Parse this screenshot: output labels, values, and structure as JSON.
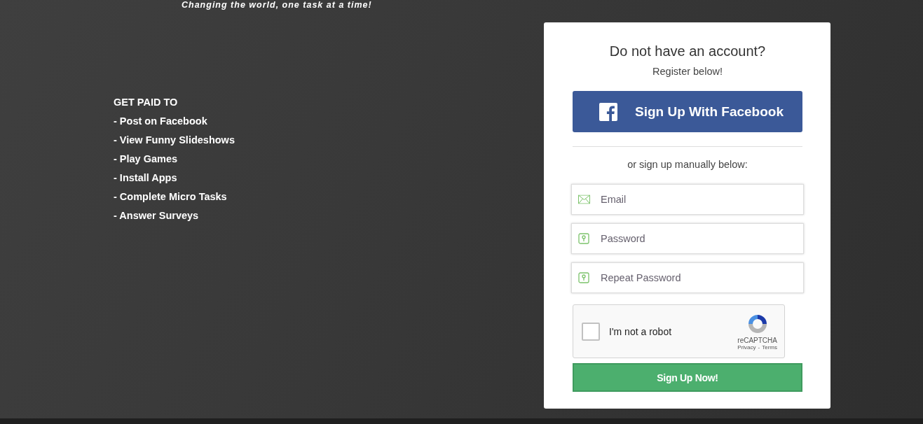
{
  "tagline": "Changing the world, one task at a time!",
  "promo": {
    "heading": "GET PAID TO",
    "items": [
      "- Post on Facebook",
      "- View Funny Slideshows",
      "- Play Games",
      "- Install Apps",
      "- Complete Micro Tasks",
      "- Answer Surveys"
    ]
  },
  "signup": {
    "title": "Do not have an account?",
    "subtitle": "Register below!",
    "facebook_button": "Sign Up With Facebook",
    "divider_text": "or sign up manually below:",
    "fields": [
      {
        "kind": "email",
        "placeholder": "Email"
      },
      {
        "kind": "password",
        "placeholder": "Password"
      },
      {
        "kind": "password",
        "placeholder": "Repeat Password"
      }
    ],
    "captcha": {
      "label": "I'm not a robot",
      "checked": false,
      "brand": "reCAPTCHA",
      "links": [
        "Privacy",
        "Terms"
      ],
      "separator": "-"
    },
    "submit_button": "Sign Up Now!"
  }
}
